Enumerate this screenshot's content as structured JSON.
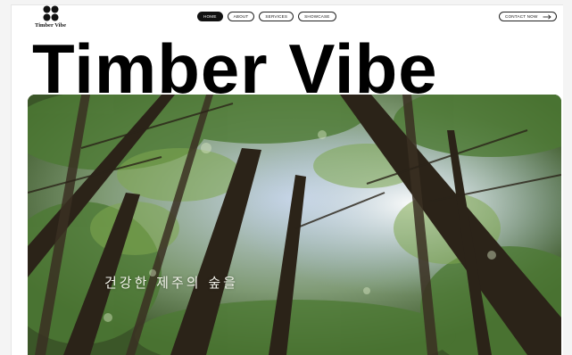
{
  "brand": {
    "name": "Timber Vibe",
    "logo_icon": "four-dot-clover-icon"
  },
  "nav": {
    "items": [
      {
        "label": "HOME",
        "active": true
      },
      {
        "label": "ABOUT",
        "active": false
      },
      {
        "label": "SERVICES",
        "active": false
      },
      {
        "label": "SHOWCASE",
        "active": false
      }
    ]
  },
  "contact": {
    "label": "CONTACT NOW",
    "icon": "arrow-right-icon"
  },
  "hero": {
    "title": "Timber Vibe",
    "caption": "건강한 제주의 숲을",
    "image_description_icon": "forest-canopy-photo"
  },
  "colors": {
    "text": "#000000",
    "accent_dark": "#111111",
    "page_bg": "#ffffff"
  }
}
